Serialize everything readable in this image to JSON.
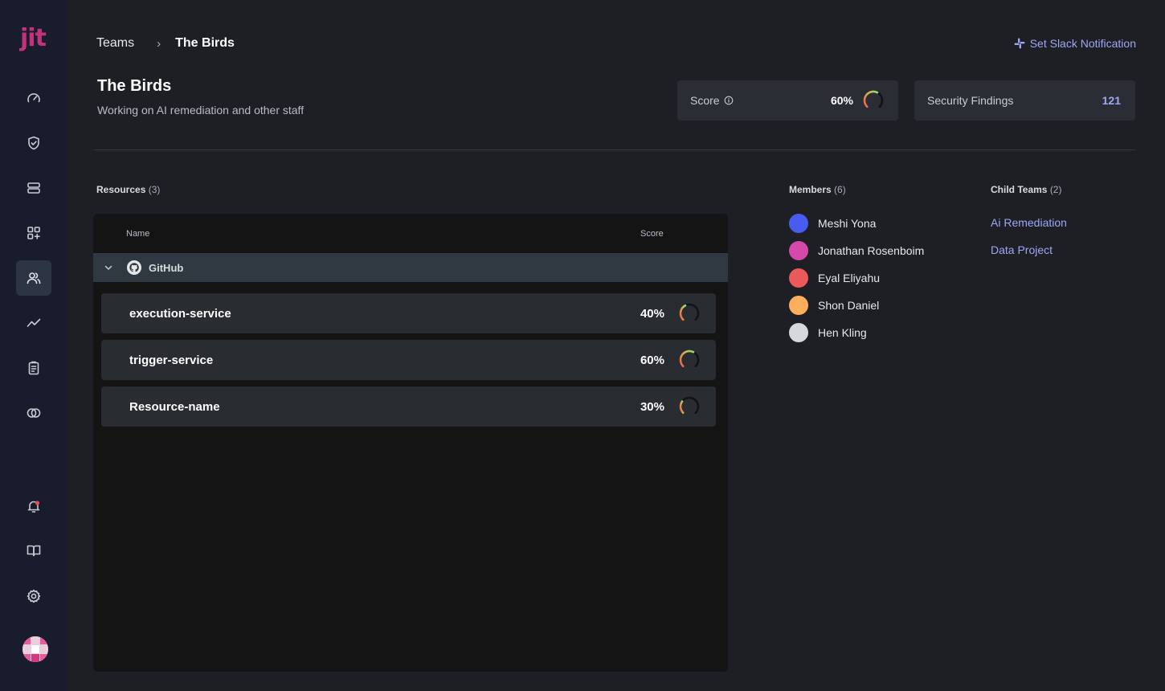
{
  "app": {
    "logo_text": "jit",
    "brand_color": "#c4327e",
    "accent_color": "#9ea7f6"
  },
  "sidebar": {
    "items": [
      {
        "icon": "dashboard-gauge-icon"
      },
      {
        "icon": "shield-check-icon"
      },
      {
        "icon": "resources-stack-icon"
      },
      {
        "icon": "integrations-grid-icon"
      },
      {
        "icon": "teams-users-icon",
        "active": true
      },
      {
        "icon": "insights-trend-icon"
      },
      {
        "icon": "reports-clipboard-icon"
      },
      {
        "icon": "plans-rings-icon"
      }
    ],
    "bottom": [
      {
        "icon": "notifications-bell-icon"
      },
      {
        "icon": "docs-book-icon"
      },
      {
        "icon": "settings-gear-icon"
      }
    ]
  },
  "breadcrumb": {
    "root": "Teams",
    "separator": "›",
    "current": "The Birds"
  },
  "slack": {
    "label": "Set Slack Notification",
    "icon": "slack-icon"
  },
  "team": {
    "title": "The Birds",
    "description": "Working on AI remediation and other staff"
  },
  "stats": {
    "score": {
      "label": "Score",
      "value": "60%",
      "fraction": 0.6
    },
    "findings": {
      "label": "Security Findings",
      "value": "121"
    }
  },
  "resources": {
    "title": "Resources",
    "count": "(3)",
    "columns": {
      "name": "Name",
      "score": "Score"
    },
    "group": {
      "name": "GitHub",
      "icon": "github-icon"
    },
    "rows": [
      {
        "name": "execution-service",
        "score": "40%",
        "fraction": 0.4
      },
      {
        "name": "trigger-service",
        "score": "60%",
        "fraction": 0.6
      },
      {
        "name": "Resource-name",
        "score": "30%",
        "fraction": 0.3
      }
    ]
  },
  "members": {
    "title": "Members",
    "count": "(6)",
    "list": [
      {
        "name": "Meshi Yona",
        "color": "#4a5cf0"
      },
      {
        "name": "Jonathan Rosenboim",
        "color": "#d54aa8"
      },
      {
        "name": "Eyal Eliyahu",
        "color": "#eb5a5a"
      },
      {
        "name": "Shon Daniel",
        "color": "#ffae5c"
      },
      {
        "name": "Hen Kling",
        "color": "#d7d8db"
      }
    ]
  },
  "child_teams": {
    "title": "Child Teams",
    "count": "(2)",
    "list": [
      {
        "name": "Ai Remediation"
      },
      {
        "name": "Data Project"
      }
    ]
  }
}
